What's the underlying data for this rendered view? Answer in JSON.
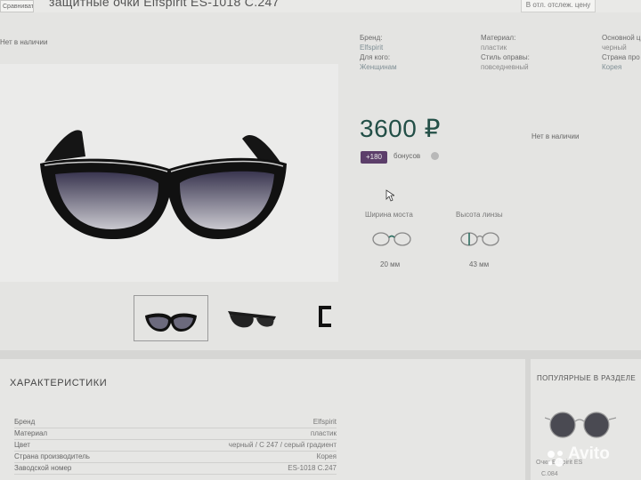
{
  "header": {
    "compare_label": "Сравнивать",
    "title": "защитные очки Elfspirit ES-1018 C.247",
    "cart_label": "В отл. отслеж. цену"
  },
  "product": {
    "stock_left": "Нет в наличии",
    "price": "3600 ₽",
    "stock_right": "Нет в наличии",
    "bonus_badge": "+180",
    "bonus_label": "бонусов"
  },
  "attributes": [
    {
      "key": "Бренд:",
      "value": "Elfspirit"
    },
    {
      "key": "Для кого:",
      "value": "Женщинам"
    },
    {
      "key": "Материал:",
      "value": "пластик"
    },
    {
      "key": "Стиль оправы:",
      "value": "повседневный"
    },
    {
      "key": "Основной ц",
      "value": "черный"
    },
    {
      "key": "Страна про",
      "value": "Корея"
    }
  ],
  "measurements": [
    {
      "label": "Ширина моста",
      "value": "20 мм"
    },
    {
      "label": "Высота линзы",
      "value": "43 мм"
    }
  ],
  "characteristics": {
    "title": "ХАРАКТЕРИСТИКИ",
    "rows": [
      {
        "key": "Бренд",
        "value": "Elfspirit"
      },
      {
        "key": "Материал",
        "value": "пластик"
      },
      {
        "key": "Цвет",
        "value": "черный / С 247 / серый градиент"
      },
      {
        "key": "Страна производитель",
        "value": "Корея"
      },
      {
        "key": "Заводской номер",
        "value": "ES-1018 C.247"
      }
    ]
  },
  "popular": {
    "title": "ПОПУЛЯРНЫЕ В РАЗДЕЛЕ",
    "caption": "Очки Elfspirit ES",
    "code": "С.084"
  },
  "watermark": "Avito",
  "colors": {
    "price": "#234f47",
    "bonus_badge": "#5c3e6a",
    "background": "#d6d6d4"
  },
  "icons": [
    "info-icon",
    "bridge-width-icon",
    "lens-height-icon",
    "avito-logo"
  ]
}
